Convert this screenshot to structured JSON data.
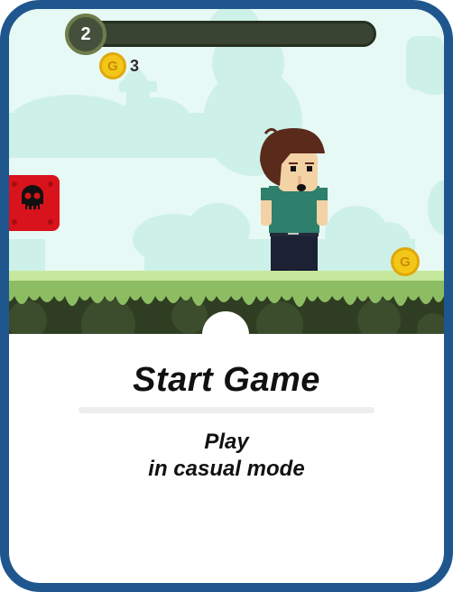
{
  "hud": {
    "level": "2",
    "progress": 0,
    "coins": "3",
    "coin_symbol": "G"
  },
  "scene": {
    "ground_coin_symbol": "G"
  },
  "card": {
    "title": "Start Game",
    "subtitle_line1": "Play",
    "subtitle_line2": "in casual mode"
  },
  "colors": {
    "border": "#1f568e",
    "sky": "#e6f9f4",
    "grass": "#8dbd62",
    "coin": "#f3c717",
    "enemy": "#d9131b"
  }
}
